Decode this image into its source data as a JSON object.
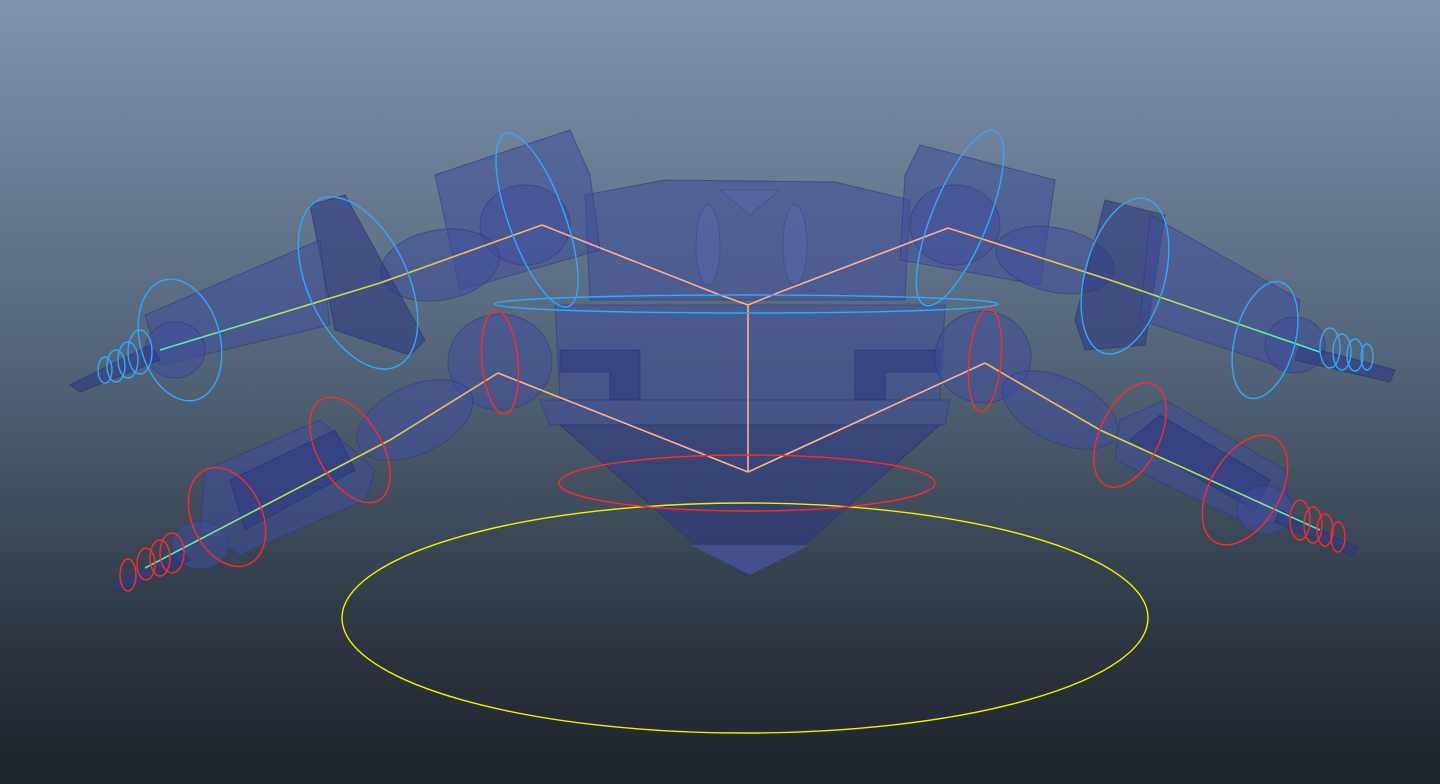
{
  "viewport": {
    "panel": "perspective-viewport",
    "background_gradient": [
      "#8193ac",
      "#6a7d94",
      "#4a5a6d",
      "#2c3540",
      "#1d232a"
    ]
  },
  "colors": {
    "mesh": "#3f4f9b",
    "left_side_controls": "#2fa8ff",
    "right_side_controls": "#ff2a2a",
    "root_control": "#f2f000",
    "spine_bones": "#ffb08a",
    "limb_bones_start": "#ffb060",
    "limb_bones_end": "#3ef0c0"
  },
  "scene": {
    "rig": "spider-crab-character",
    "limb_count": 4,
    "controls": [
      "root-control",
      "hip-control",
      "shoulder-control",
      "limb-fk-controls",
      "finger-controls"
    ]
  }
}
